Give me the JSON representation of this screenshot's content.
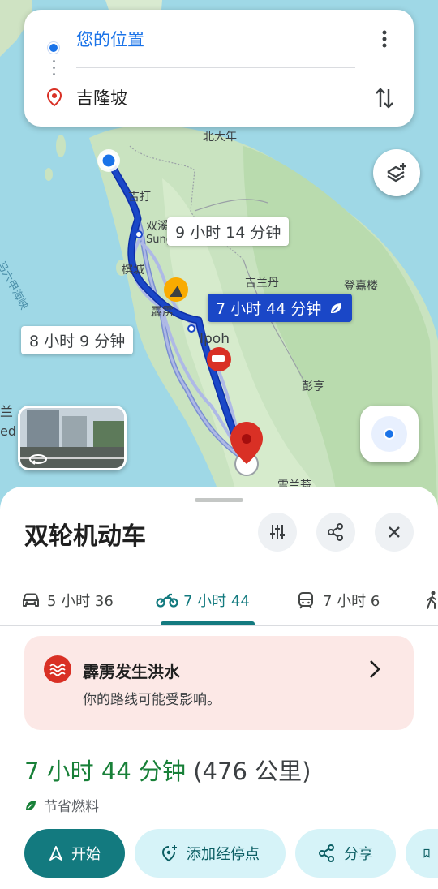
{
  "search": {
    "origin": "您的位置",
    "destination": "吉隆坡"
  },
  "map": {
    "labels": {
      "north_da_nian": "北大年",
      "kedah": "吉打",
      "shuangxi": "双溪",
      "sungai_petani": "Sungai Petani",
      "penang": "槟城",
      "perak": "霹雳",
      "ipoh": "Ipoh",
      "kelantan": "吉兰丹",
      "terengganu": "登嘉楼",
      "pahang": "彭亨",
      "selangor": "雪兰莪",
      "sea": "马六甲海峡",
      "left_edge_1": "兰",
      "left_edge_2": "ed"
    },
    "route_bubbles": {
      "alt1": "9 小时 14 分钟",
      "selected": "7 小时 44 分钟",
      "alt2": "8 小时 9 分钟"
    }
  },
  "sheet": {
    "title": "双轮机动车",
    "tabs": [
      {
        "label": "5 小时 36",
        "mode": "car"
      },
      {
        "label": "7 小时 44",
        "mode": "motorcycle"
      },
      {
        "label": "7 小时 6",
        "mode": "transit"
      }
    ],
    "alert": {
      "title": "霹雳发生洪水",
      "subtitle": "你的路线可能受影响。"
    },
    "summary": {
      "time": "7 小时 44 分钟",
      "distance": "(476 公里)"
    },
    "eco_label": "节省燃料",
    "actions": {
      "start": "开始",
      "add_stop": "添加经停点",
      "share": "分享"
    }
  },
  "colors": {
    "accent": "#137a7f",
    "route_selected": "#1a47c7",
    "alert_bg": "#fce8e6",
    "alert_icon": "#d93025",
    "summary_time": "#188038"
  }
}
